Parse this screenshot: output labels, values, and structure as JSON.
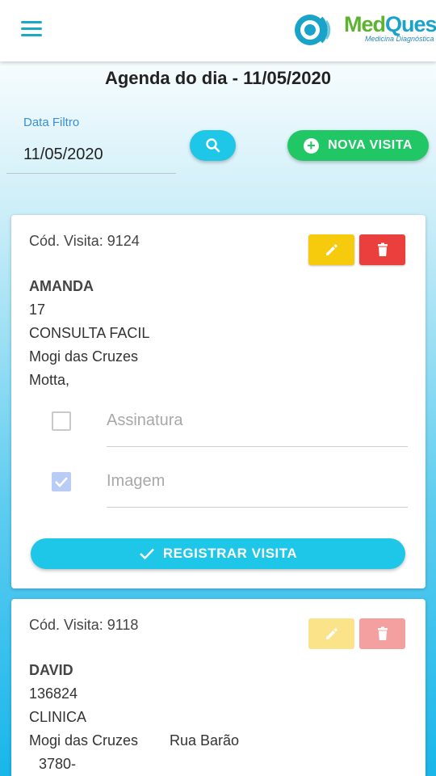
{
  "app": {
    "logo_med": "Med",
    "logo_quest": "Quest",
    "logo_subtitle": "Medicina Diagnóstica"
  },
  "page": {
    "title": "Agenda do dia - 11/05/2020"
  },
  "filter": {
    "label": "Data Filtro",
    "value": "11/05/2020"
  },
  "actions": {
    "nova_visita_label": "NOVA VISITA"
  },
  "visits": [
    {
      "cod_label": "Cód. Visita: 9124",
      "name": "AMANDA",
      "phone": "17",
      "company": "CONSULTA FACIL",
      "city": "Mogi das Cruzes",
      "address": "Motta,",
      "checks": [
        {
          "label": "Assinatura",
          "checked": false
        },
        {
          "label": "Imagem",
          "checked": true
        }
      ],
      "register_label": "REGISTRAR VISITA"
    },
    {
      "cod_label": "Cód. Visita: 9118",
      "name": "DAVID",
      "phone": "136824",
      "company": "CLINICA",
      "city": "Mogi das Cruzes",
      "street": "Rua Barão",
      "extra": "3780-"
    }
  ],
  "colors": {
    "primary": "#1ec6e8",
    "success": "#20c764",
    "edit": "#f6cb0e",
    "delete": "#ea3f3d",
    "label_blue": "#3b8fcf"
  },
  "icons": {
    "menu": "menu-icon",
    "search": "search-icon",
    "add": "plus-circle-icon",
    "edit": "pencil-icon",
    "delete": "trash-icon",
    "check": "check-icon"
  }
}
